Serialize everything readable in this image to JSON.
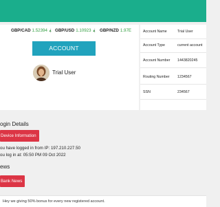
{
  "ticker": [
    {
      "pair": "GBP/CAD",
      "value": "1.52394",
      "arrow": "▲"
    },
    {
      "pair": "GBP/USD",
      "value": "1.10923",
      "arrow": "▲"
    },
    {
      "pair": "GBP/NZD",
      "value": "1.97E",
      "arrow": ""
    }
  ],
  "overview": {
    "button_label": "ACCOUNT OVERVIEW",
    "user_name": "Trial User"
  },
  "account_table": [
    {
      "label": "Account Name",
      "value": "Trial User"
    },
    {
      "label": "Account Type",
      "value": "current account"
    },
    {
      "label": "Account Number",
      "value": "1443820245"
    },
    {
      "label": "Routing Number",
      "value": "1234567"
    },
    {
      "label": "SSN",
      "value": "234567"
    }
  ],
  "login": {
    "title": "ogin Details",
    "device_button": "Device Information",
    "ip_line": "ou have logged in from IP: 197.210.227.50",
    "time_line": "ou log in at: 05:50 PM 09 Oct 2022"
  },
  "news": {
    "title": "ews",
    "button": "Bank News"
  },
  "promo": {
    "text": "Hey we giving 50% bonus for every new registered account."
  },
  "colors": {
    "header": "#1aae8c",
    "accent": "#21a3bd",
    "danger": "#dc3545",
    "up": "#2e9c3d"
  },
  "icons": [
    "avatar-photo",
    "arrow-up-icon"
  ]
}
